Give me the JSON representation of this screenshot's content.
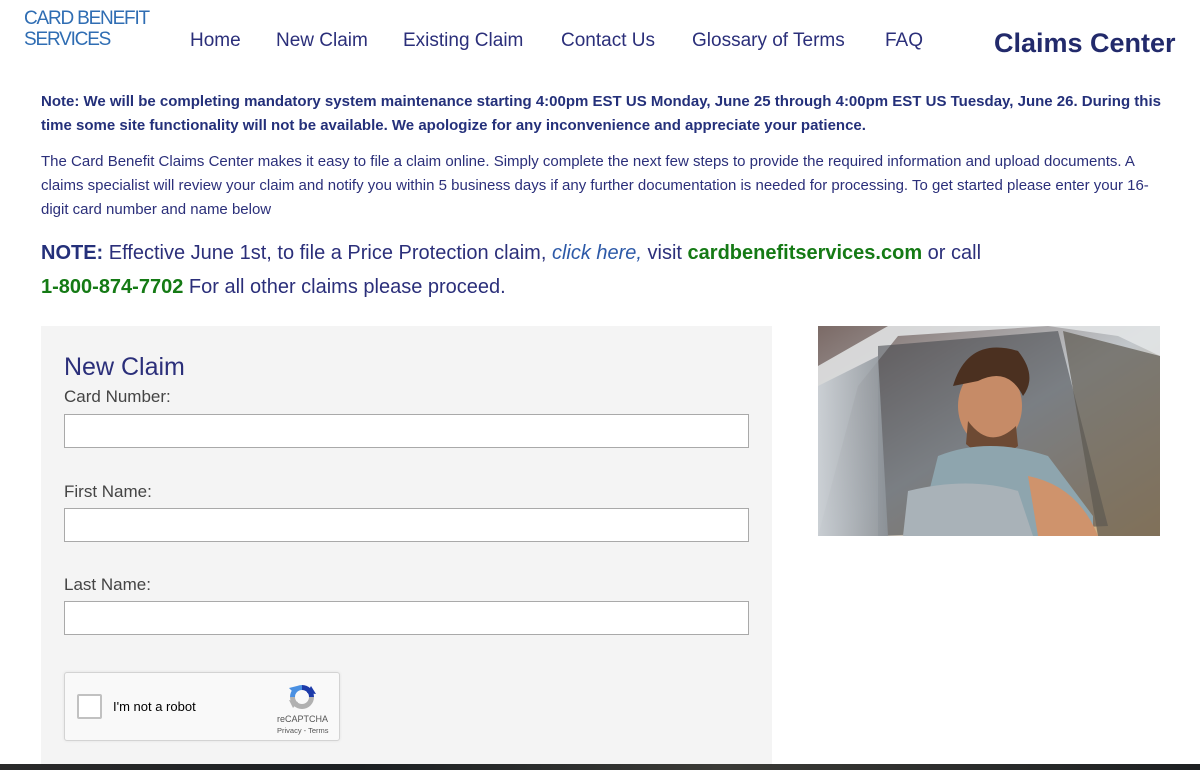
{
  "header": {
    "logo_line1": "CARD BENEFIT",
    "logo_line2": "SERVICES",
    "nav": [
      {
        "label": "Home"
      },
      {
        "label": "New Claim"
      },
      {
        "label": "Existing Claim"
      },
      {
        "label": "Contact Us"
      },
      {
        "label": "Glossary of Terms"
      },
      {
        "label": "FAQ"
      }
    ],
    "section_title": "Claims Center"
  },
  "notices": {
    "maintenance": "Note: We will be completing mandatory system maintenance starting 4:00pm EST US Monday, June 25 through 4:00pm EST US Tuesday, June 26. During this time some site functionality will not be available. We apologize for any inconvenience and appreciate your patience.",
    "intro": "The Card Benefit Claims Center makes it easy to file a claim online. Simply complete the next few steps to provide the required information and upload documents. A claims specialist will review your claim and notify you within 5 business days if any further documentation is needed for processing. To get started please enter your 16-digit card number and name below",
    "price_protection": {
      "label": "NOTE:",
      "text1": " Effective June 1st, to file a Price Protection claim, ",
      "link": "click here,",
      "text2": " visit ",
      "website": "cardbenefitservices.com",
      "text3": " or call",
      "phone": "1-800-874-7702",
      "text4": " For all other claims please proceed."
    }
  },
  "form": {
    "title": "New Claim",
    "card_number_label": "Card Number:",
    "card_number_value": "",
    "first_name_label": "First Name:",
    "first_name_value": "",
    "last_name_label": "Last Name:",
    "last_name_value": "",
    "captcha": {
      "label": "I'm not a robot",
      "brand": "reCAPTCHA",
      "privacy": "Privacy",
      "separator": " - ",
      "terms": "Terms",
      "checked": false
    }
  },
  "photo": {
    "alt": "Smiling man driving a car"
  },
  "colors": {
    "navy": "#2b2f7a",
    "logo_blue": "#2f6db3",
    "green": "#157a15",
    "link_blue": "#2d5aa8",
    "panel_bg": "#f4f4f4"
  }
}
